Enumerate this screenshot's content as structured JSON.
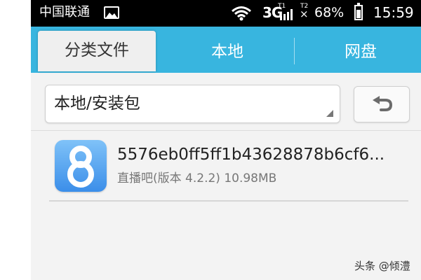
{
  "status_bar": {
    "carrier": "中国联通",
    "network": "3G",
    "signal_sub": "T1",
    "sim2_label": "T2",
    "sim2_mark": "×",
    "battery": "68%",
    "time": "15:59",
    "icons": [
      "image-icon",
      "wifi-icon",
      "signal-icon",
      "battery-icon"
    ]
  },
  "tabs": [
    {
      "label": "分类文件",
      "active": true
    },
    {
      "label": "本地",
      "active": false
    },
    {
      "label": "网盘",
      "active": false
    }
  ],
  "path_bar": {
    "current_path": "本地/安装包",
    "back_icon": "back-arrow-icon"
  },
  "files": [
    {
      "name": "5576eb0ff5ff1b43628878b6cf6...",
      "detail": "直播吧(版本 4.2.2) 10.98MB",
      "icon": "app-8-icon"
    }
  ],
  "watermark": "头条 @倾澧",
  "colors": {
    "tab_bar": "#38b5df",
    "status_bar": "#000000",
    "app_icon": "#3b8ee9"
  }
}
